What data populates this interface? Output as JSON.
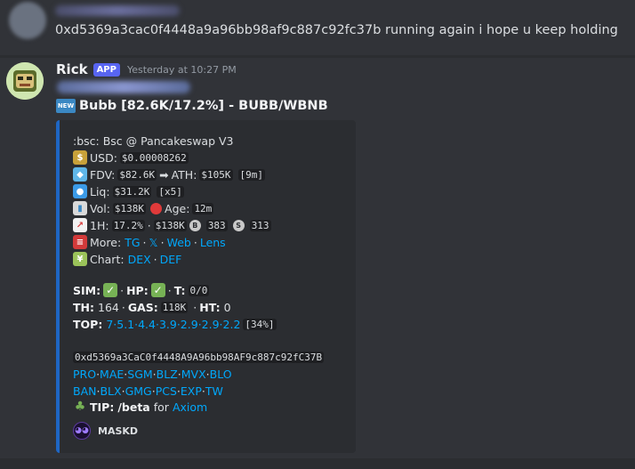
{
  "previous_message": {
    "text": "0xd5369a3cac0f4448a9a96bb98af9c887c92fc37b running again i hope u keep holding"
  },
  "message": {
    "username": "Rick",
    "tag": "APP",
    "timestamp": "Yesterday at 10:27 PM",
    "title_badge": "NEW",
    "title": "Bubb [82.6K/17.2%] - BUBB/WBNB"
  },
  "embed": {
    "accent_color": "#1e66c4",
    "chain_line": ":bsc: Bsc @ Pancakeswap V3",
    "usd": {
      "label": "USD:",
      "value": "$0.00008262"
    },
    "fdv": {
      "label": "FDV:",
      "value": "$82.6K",
      "arrow": "➡",
      "ath_label": "ATH:",
      "ath_value": "$105K",
      "ath_age": "[9m]"
    },
    "liq": {
      "label": "Liq:",
      "value": "$31.2K",
      "mult": "[x5]"
    },
    "vol": {
      "label": "Vol:",
      "value": "$138K",
      "age_label": "Age:",
      "age_value": "12m"
    },
    "one_h": {
      "label": "1H:",
      "pct": "17.2%",
      "sep": "·",
      "vol": "$138K",
      "buys": "383",
      "sells": "313"
    },
    "more": {
      "label": "More:",
      "links": [
        "TG",
        "𝕏",
        "Web",
        "Lens"
      ]
    },
    "chart": {
      "label": "Chart:",
      "links": [
        "DEX",
        "DEF"
      ]
    },
    "sim": {
      "label": "SIM:",
      "hp_label": "HP:",
      "t_label": "T:",
      "t_value": "0/0"
    },
    "th": {
      "label": "TH:",
      "value": "164",
      "gas_label": "GAS:",
      "gas_value": "118K",
      "ht_label": "HT:",
      "ht_value": "0"
    },
    "top": {
      "label": "TOP:",
      "values": "7·5.1·4.4·3.9·2.9·2.9·2.2",
      "pct": "[34%]"
    },
    "contract": "0xd5369a3CaC0f4448A9A96bb98AF9c887c92fC37B",
    "links_row1": [
      "PRO",
      "MAE",
      "SGM",
      "BLZ",
      "MVX",
      "BLO"
    ],
    "links_row2": [
      "BAN",
      "BLX",
      "GMG",
      "PCS",
      "EXP",
      "TW"
    ],
    "tip": {
      "label": "TIP:",
      "command": "/beta",
      "for": "for",
      "target": "Axiom"
    },
    "footer": "MASKD"
  }
}
